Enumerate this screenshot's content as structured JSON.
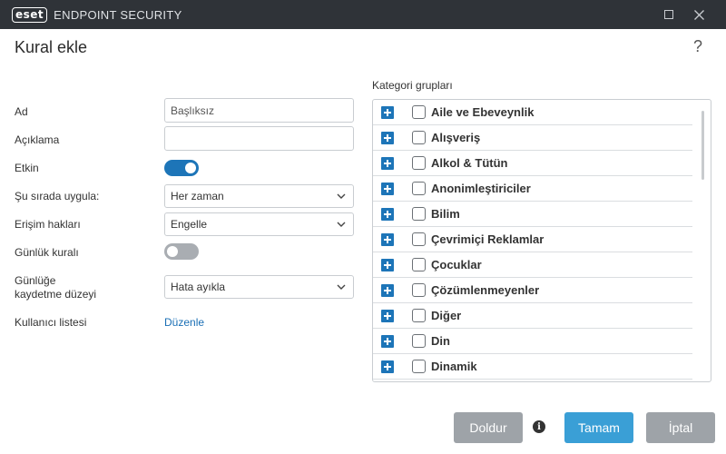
{
  "window": {
    "logo_text": "eset",
    "product_name": "ENDPOINT SECURITY"
  },
  "header": {
    "title": "Kural ekle",
    "help_symbol": "?"
  },
  "form": {
    "name_label": "Ad",
    "name_placeholder": "Başlıksız",
    "description_label": "Açıklama",
    "description_value": "",
    "enabled_label": "Etkin",
    "enabled": true,
    "apply_label": "Şu sırada uygula:",
    "apply_value": "Her zaman",
    "access_label": "Erişim hakları",
    "access_value": "Engelle",
    "log_rule_label": "Günlük kuralı",
    "log_rule": false,
    "log_level_label_line1": "Günlüğe",
    "log_level_label_line2": "kaydetme düzeyi",
    "log_level_value": "Hata ayıkla",
    "user_list_label": "Kullanıcı listesi",
    "user_list_link": "Düzenle"
  },
  "categories": {
    "title": "Kategori grupları",
    "items": [
      {
        "label": "Aile ve Ebeveynlik",
        "checked": false
      },
      {
        "label": "Alışveriş",
        "checked": false
      },
      {
        "label": "Alkol & Tütün",
        "checked": false
      },
      {
        "label": "Anonimleştiriciler",
        "checked": false
      },
      {
        "label": "Bilim",
        "checked": false
      },
      {
        "label": "Çevrimiçi Reklamlar",
        "checked": false
      },
      {
        "label": "Çocuklar",
        "checked": false
      },
      {
        "label": "Çözümlenmeyenler",
        "checked": false
      },
      {
        "label": "Diğer",
        "checked": false
      },
      {
        "label": "Din",
        "checked": false
      },
      {
        "label": "Dinamik",
        "checked": false
      }
    ]
  },
  "footer": {
    "fill_label": "Doldur",
    "ok_label": "Tamam",
    "cancel_label": "İptal"
  },
  "colors": {
    "titlebar": "#2f3338",
    "accent": "#1d75b8",
    "primary_button": "#3a9fd6",
    "secondary_button": "#9ea3a8"
  }
}
